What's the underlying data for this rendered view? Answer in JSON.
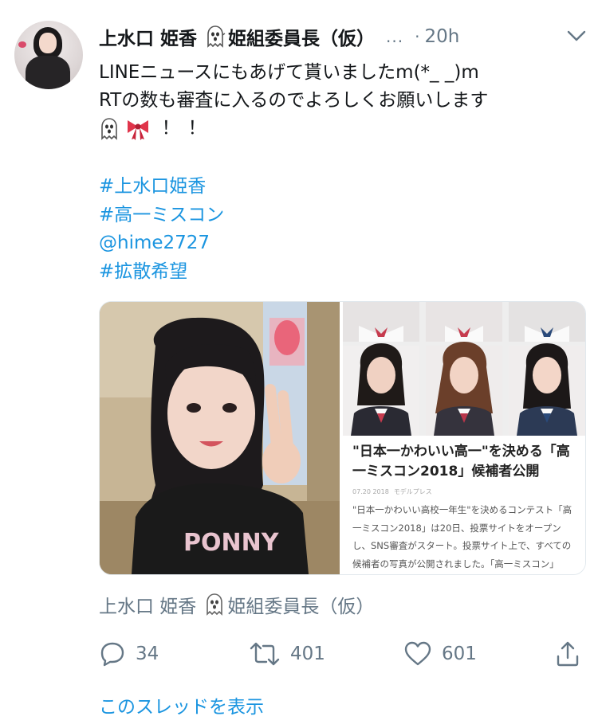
{
  "tweet": {
    "author_name": "上水口 姫香",
    "author_title": "姫組委員長（仮）",
    "ellipsis": "...",
    "separator": "·",
    "time": "20h",
    "text_lines": [
      "LINEニュースにもあげて貰いましたm(*_ _)m",
      "RTの数も審査に入るのでよろしくお願いします"
    ],
    "text_end": "！！",
    "hashtags": [
      "#上水口姫香",
      "#高一ミスコン",
      "@hime2727",
      "#拡散希望"
    ],
    "caption_name": "上水口 姫香",
    "caption_title": "姫組委員長（仮）",
    "actions": {
      "replies": "34",
      "retweets": "401",
      "likes": "601"
    },
    "show_thread": "このスレッドを表示"
  },
  "article": {
    "headline": "\"日本一かわいい高一\"を決める「高一ミスコン2018」候補者公開",
    "meta_date": "07.20 2018",
    "meta_source": "モデルプレス",
    "body": "\"日本一かわいい高校一年生\"を決めるコンテスト「高一ミスコン2018」は20日、投票サイトをオープンし、SNS審査がスタート。投票サイト上で、すべての候補者の写真が公開されました。「高一ミスコン」は\"日本一かわいい女子高"
  },
  "photo_shirt_text": "PONNY",
  "colors": {
    "link": "#1b95e0",
    "secondary": "#657786",
    "text": "#14171a"
  },
  "icons": {
    "ghost": "ghost-emoji",
    "ribbon": "ribbon-emoji",
    "reply": "reply-icon",
    "retweet": "retweet-icon",
    "like": "heart-icon",
    "share": "share-icon",
    "menu": "chevron-down-icon"
  }
}
